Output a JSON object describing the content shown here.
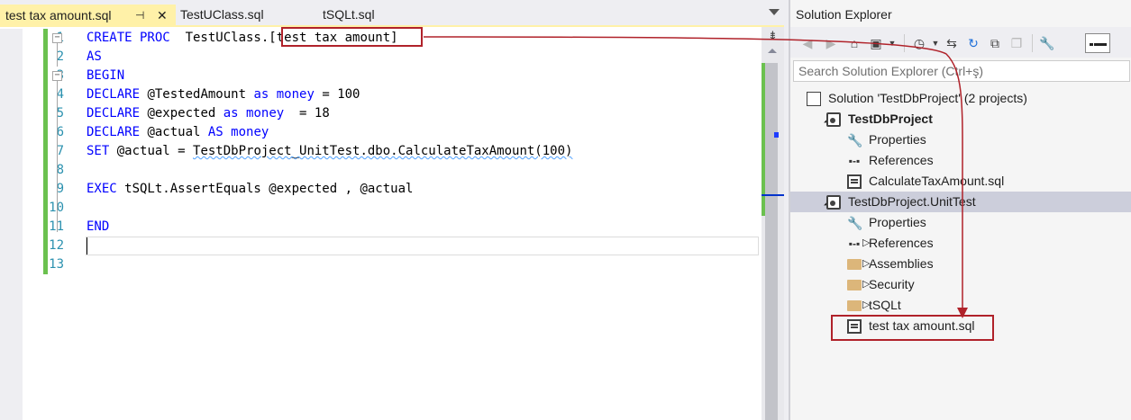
{
  "editor": {
    "tabs": [
      {
        "label": "test tax amount.sql",
        "active": true
      },
      {
        "label": "TestUClass.sql",
        "active": false
      },
      {
        "label": "tSQLt.sql",
        "active": false
      }
    ],
    "pin_glyph": "⊣",
    "close_glyph": "✕",
    "lines": [
      {
        "n": "1",
        "tokens": [
          [
            "kw",
            "CREATE PROC"
          ],
          [
            "ident",
            "  TestUClass."
          ],
          [
            "ident",
            "[test tax amount]"
          ]
        ],
        "collapse": "−"
      },
      {
        "n": "2",
        "tokens": [
          [
            "kw",
            "AS"
          ]
        ]
      },
      {
        "n": "3",
        "tokens": [
          [
            "kw",
            "BEGIN"
          ]
        ],
        "collapse": "−"
      },
      {
        "n": "4",
        "tokens": [
          [
            "kw",
            "DECLARE"
          ],
          [
            "ident",
            " @TestedAmount "
          ],
          [
            "kw",
            "as"
          ],
          [
            "ident",
            " "
          ],
          [
            "kw",
            "money"
          ],
          [
            "ident",
            " = 100"
          ]
        ]
      },
      {
        "n": "5",
        "tokens": [
          [
            "kw",
            "DECLARE"
          ],
          [
            "ident",
            " @expected "
          ],
          [
            "kw",
            "as"
          ],
          [
            "ident",
            " "
          ],
          [
            "kw",
            "money"
          ],
          [
            "ident",
            "  = 18"
          ]
        ]
      },
      {
        "n": "6",
        "tokens": [
          [
            "kw",
            "DECLARE"
          ],
          [
            "ident",
            " @actual "
          ],
          [
            "kw",
            "AS"
          ],
          [
            "ident",
            " "
          ],
          [
            "kw",
            "money"
          ]
        ]
      },
      {
        "n": "7",
        "tokens": [
          [
            "kw",
            "SET"
          ],
          [
            "ident",
            " @actual = "
          ],
          [
            "squiggle",
            "TestDbProject_UnitTest.dbo.CalculateTaxAmount(100)"
          ]
        ]
      },
      {
        "n": "8",
        "tokens": []
      },
      {
        "n": "9",
        "tokens": [
          [
            "kw",
            "EXEC"
          ],
          [
            "ident",
            " tSQLt.AssertEquals @expected , @actual"
          ]
        ]
      },
      {
        "n": "10",
        "tokens": []
      },
      {
        "n": "11",
        "tokens": [
          [
            "kw",
            "END"
          ]
        ]
      },
      {
        "n": "12",
        "tokens": []
      },
      {
        "n": "13",
        "tokens": []
      }
    ]
  },
  "solution_explorer": {
    "title": "Solution Explorer",
    "search_placeholder": "Search Solution Explorer (Ctrl+ş)",
    "toolbar_icons": [
      "back-icon",
      "forward-icon",
      "home-icon",
      "switch-views-icon",
      "pending-changes-icon",
      "sync-icon",
      "refresh-icon",
      "collapse-all-icon",
      "show-all-files-icon",
      "properties-icon",
      "preview-icon"
    ],
    "tree": [
      {
        "label": "Solution 'TestDbProject' (2 projects)",
        "icon": "solution-icon",
        "expander": "",
        "bold": false,
        "selected": false
      },
      {
        "label": "TestDbProject",
        "icon": "database-project-icon",
        "expander": "◢",
        "bold": true,
        "selected": false
      },
      {
        "label": "Properties",
        "icon": "wrench-icon",
        "expander": "",
        "bold": false,
        "selected": false
      },
      {
        "label": "References",
        "icon": "references-icon",
        "expander": "",
        "bold": false,
        "selected": false
      },
      {
        "label": "CalculateTaxAmount.sql",
        "icon": "sql-file-icon",
        "expander": "",
        "bold": false,
        "selected": false
      },
      {
        "label": "TestDbProject.UnitTest",
        "icon": "database-project-icon",
        "expander": "◢",
        "bold": false,
        "selected": true
      },
      {
        "label": "Properties",
        "icon": "wrench-icon",
        "expander": "",
        "bold": false,
        "selected": false
      },
      {
        "label": "References",
        "icon": "references-icon",
        "expander": "▷",
        "bold": false,
        "selected": false
      },
      {
        "label": "Assemblies",
        "icon": "folder-icon",
        "expander": "▷",
        "bold": false,
        "selected": false
      },
      {
        "label": "Security",
        "icon": "folder-icon",
        "expander": "▷",
        "bold": false,
        "selected": false
      },
      {
        "label": "tSQLt",
        "icon": "folder-icon",
        "expander": "▷",
        "bold": false,
        "selected": false
      },
      {
        "label": "test tax amount.sql",
        "icon": "sql-file-icon",
        "expander": "",
        "bold": false,
        "selected": false
      }
    ]
  },
  "colors": {
    "active_tab": "#fff1a8",
    "keyword": "#0000ff",
    "line_number": "#2b91af",
    "highlight_box": "#b0222a",
    "change_bar": "#6bc14f",
    "selected_row": "#cccedb"
  }
}
